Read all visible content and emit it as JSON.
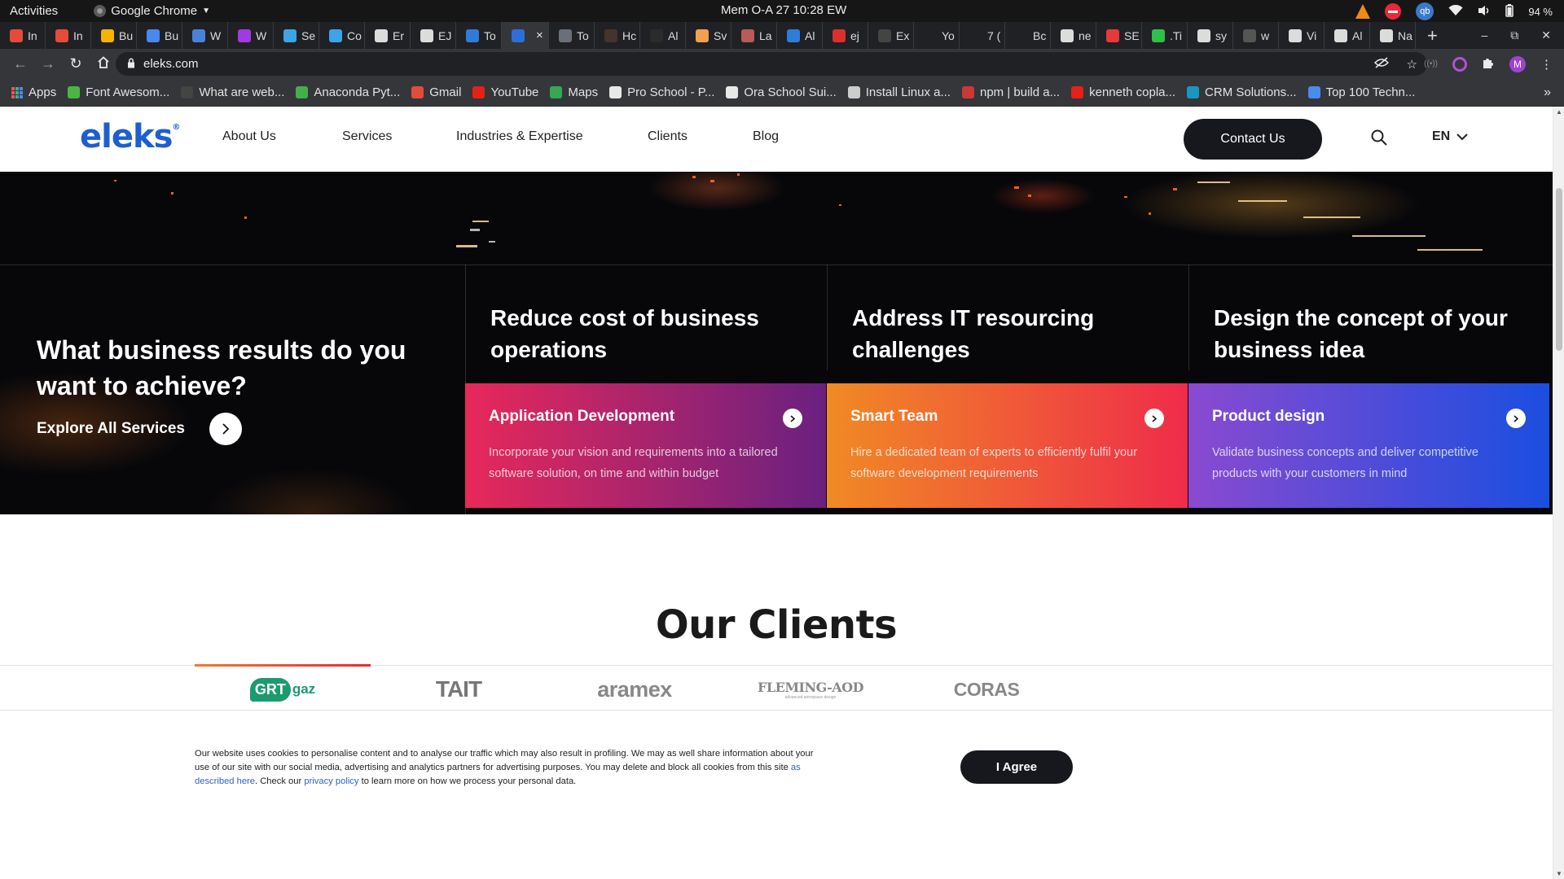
{
  "os_bar": {
    "activities": "Activities",
    "app_name": "Google Chrome",
    "clock": "Mem O-A 27  10:28 EW",
    "battery": "94 %",
    "qb_label": "qb"
  },
  "tabs": [
    {
      "label": "In",
      "icon": "gmail-icon",
      "color": "#e44b3b"
    },
    {
      "label": "In",
      "icon": "gmail-icon",
      "color": "#e44b3b"
    },
    {
      "label": "Bu",
      "icon": "drive-icon",
      "color": "#f4b400"
    },
    {
      "label": "Bu",
      "icon": "docs-icon",
      "color": "#4a87ee"
    },
    {
      "label": "W",
      "icon": "wave-icon",
      "color": "#4b82d8"
    },
    {
      "label": "W",
      "icon": "p-icon",
      "color": "#a13ae0"
    },
    {
      "label": "Se",
      "icon": "k-icon",
      "color": "#3ca4e8"
    },
    {
      "label": "Co",
      "icon": "k-icon",
      "color": "#3ca4e8"
    },
    {
      "label": "Er",
      "icon": "globe-icon",
      "color": "#dcdcdc"
    },
    {
      "label": "EJ",
      "icon": "globe-icon",
      "color": "#dcdcdc"
    },
    {
      "label": "To",
      "icon": "todo-icon",
      "color": "#2f7bd8"
    },
    {
      "label": "",
      "icon": "eleks-icon",
      "color": "#2d6fd6",
      "active": true
    },
    {
      "label": "To",
      "icon": "circle-icon",
      "color": "#6a6f7a"
    },
    {
      "label": "Hc",
      "icon": "dark-icon",
      "color": "#45332e"
    },
    {
      "label": "Al",
      "icon": "dev-icon",
      "color": "#2b2b2b"
    },
    {
      "label": "Sv",
      "icon": "sp-icon",
      "color": "#f0a050"
    },
    {
      "label": "La",
      "icon": "photo-icon",
      "color": "#b85b5b"
    },
    {
      "label": "Al",
      "icon": "bar-icon",
      "color": "#2e7dd8"
    },
    {
      "label": "ej",
      "icon": "n-icon",
      "color": "#d93030"
    },
    {
      "label": "Ex",
      "icon": "ex-icon",
      "color": "#444"
    },
    {
      "label": "Yo",
      "icon": "m-icon",
      "color": "#202124"
    },
    {
      "label": "7 (",
      "icon": "m-icon",
      "color": "#202124"
    },
    {
      "label": "Bc",
      "icon": "m-icon",
      "color": "#202124"
    },
    {
      "label": "ne",
      "icon": "google-icon",
      "color": "#dcdcdc"
    },
    {
      "label": "SE",
      "icon": "wave-red-icon",
      "color": "#e63a3a"
    },
    {
      "label": ".Ti",
      "icon": "dot-icon",
      "color": "#2ec04a"
    },
    {
      "label": "sy",
      "icon": "google-icon",
      "color": "#dcdcdc"
    },
    {
      "label": "w",
      "icon": "grey-icon",
      "color": "#555"
    },
    {
      "label": "Vi",
      "icon": "globe-icon",
      "color": "#dcdcdc"
    },
    {
      "label": "Al",
      "icon": "globe-icon",
      "color": "#dcdcdc"
    },
    {
      "label": "Na",
      "icon": "globe-icon",
      "color": "#dcdcdc"
    }
  ],
  "tab_letters": [
    "M",
    "M",
    "M"
  ],
  "tab_close": "×",
  "new_tab": "+",
  "window_controls": [
    "‒",
    "⧉",
    "✕"
  ],
  "omnibox": {
    "url": "eleks.com"
  },
  "bookmarks": [
    {
      "label": "Apps",
      "icon": "apps-grid-icon",
      "color": "#e55"
    },
    {
      "label": "Font Awesom...",
      "icon": "flag-icon",
      "color": "#4bb543"
    },
    {
      "label": "What are web...",
      "icon": "africa-icon",
      "color": "#444"
    },
    {
      "label": "Anaconda Pyt...",
      "icon": "anaconda-icon",
      "color": "#43b049"
    },
    {
      "label": "Gmail",
      "icon": "gmail-icon",
      "color": "#e44b3b"
    },
    {
      "label": "YouTube",
      "icon": "youtube-icon",
      "color": "#e62117"
    },
    {
      "label": "Maps",
      "icon": "maps-icon",
      "color": "#34a853"
    },
    {
      "label": "Pro School - P...",
      "icon": "doc-icon",
      "color": "#e8e8e8"
    },
    {
      "label": "Ora School Sui...",
      "icon": "doc-icon",
      "color": "#e8e8e8"
    },
    {
      "label": "Install Linux a...",
      "icon": "linux-icon",
      "color": "#cccccc"
    },
    {
      "label": "npm | build a...",
      "icon": "npm-icon",
      "color": "#cb3837"
    },
    {
      "label": "kenneth copla...",
      "icon": "youtube-icon",
      "color": "#e62117"
    },
    {
      "label": "CRM Solutions...",
      "icon": "salesforce-icon",
      "color": "#1798c1"
    },
    {
      "label": "Top 100 Techn...",
      "icon": "rss-icon",
      "color": "#4a8bf0"
    }
  ],
  "bookmarks_more": "»",
  "site": {
    "logo": "eleks",
    "logo_mark": "®",
    "nav": [
      "About Us",
      "Services",
      "Industries & Expertise",
      "Clients",
      "Blog"
    ],
    "contact": "Contact Us",
    "language": "EN"
  },
  "hero": {
    "question": "What business results do you want to achieve?",
    "explore": "Explore All Services",
    "columns": [
      {
        "heading": "Reduce cost of business operations",
        "service": "Application Development",
        "description": "Incorporate your vision and requirements into a tailored software solution, on time and within budget",
        "gradient": [
          "#e8285a",
          "#6a2080"
        ]
      },
      {
        "heading": "Address IT resourcing challenges",
        "service": "Smart Team",
        "description": "Hire a dedicated team of experts to efficiently fulfil your software development requirements",
        "gradient": [
          "#f08a24",
          "#ef2c4a"
        ]
      },
      {
        "heading": "Design the concept of your business idea",
        "service": "Product design",
        "description": "Validate business concepts and deliver competitive products with your customers in mind",
        "gradient": [
          "#8a4ad0",
          "#1a4ee0"
        ]
      }
    ]
  },
  "clients": {
    "title": "Our Clients",
    "logos": [
      {
        "name": "GRTgaz",
        "part1": "GRT",
        "part2": "gaz",
        "active": true
      },
      {
        "name": "TAIT"
      },
      {
        "name": "aramex"
      },
      {
        "name": "FLEMING-AOD",
        "tagline": "advanced aerospace design"
      },
      {
        "name": "CORAS"
      }
    ]
  },
  "cookie": {
    "text_before_link": "Our website uses cookies to personalise content and to analyse our traffic which may also result in profiling. We may as well share information about your use of our site with our social media, advertising and analytics partners for advertising purposes. You may delete and block all cookies from this site ",
    "link1": "as described here",
    "text_mid": ". Check our ",
    "link2": "privacy policy",
    "text_after": " to learn more on how we process your personal data.",
    "agree": "I Agree"
  },
  "colors": {
    "brand_blue": "#1d5fd0",
    "dark_button": "#16181d",
    "client_active_bar": [
      "#f07a2a",
      "#e8283c"
    ]
  }
}
